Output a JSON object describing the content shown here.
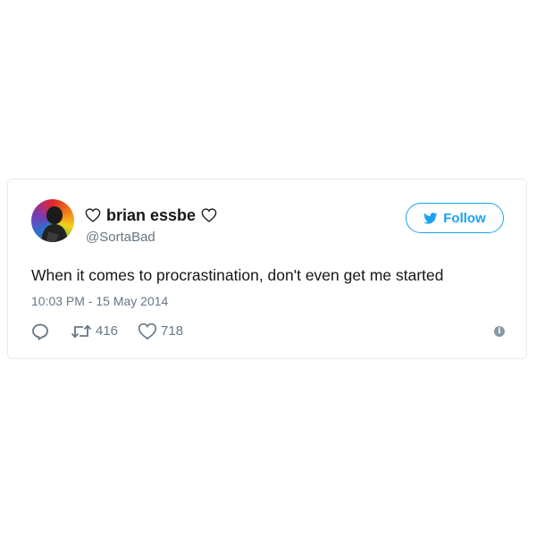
{
  "tweet": {
    "author": {
      "display_name": "brian essbe",
      "handle": "@SortaBad",
      "name_icons": [
        "heart-outline-icon",
        "heart-outline-icon"
      ],
      "avatar_icon": "profile-avatar"
    },
    "follow_button": {
      "label": "Follow",
      "icon": "twitter-bird-icon"
    },
    "text": "When it comes to procrastination, don't even get me started",
    "timestamp": "10:03 PM - 15 May 2014",
    "actions": {
      "reply": {
        "icon": "reply-icon"
      },
      "retweet": {
        "icon": "retweet-icon",
        "count": "416"
      },
      "like": {
        "icon": "heart-icon",
        "count": "718"
      },
      "info": {
        "icon": "info-icon"
      }
    }
  },
  "colors": {
    "accent": "#1da1f2",
    "text_primary": "#14171a",
    "text_secondary": "#657786",
    "border": "#e6ecf0"
  }
}
